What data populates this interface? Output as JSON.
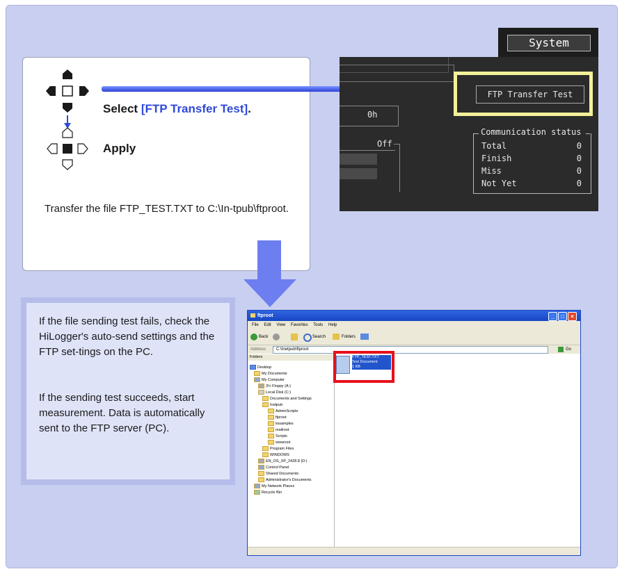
{
  "instruction": {
    "select_prefix": "Select ",
    "select_target": "[FTP Transfer Test]",
    "select_suffix": ".",
    "apply_label": "Apply",
    "note": "Transfer the file FTP_TEST.TXT to C:\\In-tpub\\ftproot."
  },
  "device_screen": {
    "system_tab": "System",
    "field_hours": "0h",
    "field_off": "Off",
    "ftp_test_button": "FTP Transfer Test",
    "comm_status_title": "Communication status",
    "comm_rows": [
      {
        "label": "Total",
        "value": "0"
      },
      {
        "label": "Finish",
        "value": "0"
      },
      {
        "label": "Miss",
        "value": "0"
      },
      {
        "label": "Not Yet",
        "value": "0"
      }
    ]
  },
  "info": {
    "fail_text": "If the file sending test fails, check the HiLogger's auto-send settings and the FTP set-tings on the PC.",
    "success_text": "If the sending test succeeds, start measurement. Data is automatically sent to the FTP server (PC)."
  },
  "explorer": {
    "title": "ftproot",
    "menu": [
      "File",
      "Edit",
      "View",
      "Favorites",
      "Tools",
      "Help"
    ],
    "toolbar": {
      "back": "Back",
      "search": "Search",
      "folders": "Folders"
    },
    "address_label": "Address",
    "address_value": "C:\\Inetpub\\ftproot",
    "go": "Go",
    "folders_header": "Folders",
    "tree": [
      "Desktop",
      "My Documents",
      "My Computer",
      "3½ Floppy (A:)",
      "Local Disk (C:)",
      "Documents and Settings",
      "Inetpub",
      "AdminScripts",
      "ftproot",
      "iissamples",
      "mailroot",
      "Scripts",
      "wwwroot",
      "Program Files",
      "WINDOWS",
      "EN_OS_XP_2428.8 (D:)",
      "Control Panel",
      "Shared Documents",
      "Administrator's Documents",
      "My Network Places",
      "Recycle Bin"
    ],
    "file": {
      "name": "FTP_TEST.TXT",
      "type": "Text Document",
      "size": "1 KB"
    }
  }
}
